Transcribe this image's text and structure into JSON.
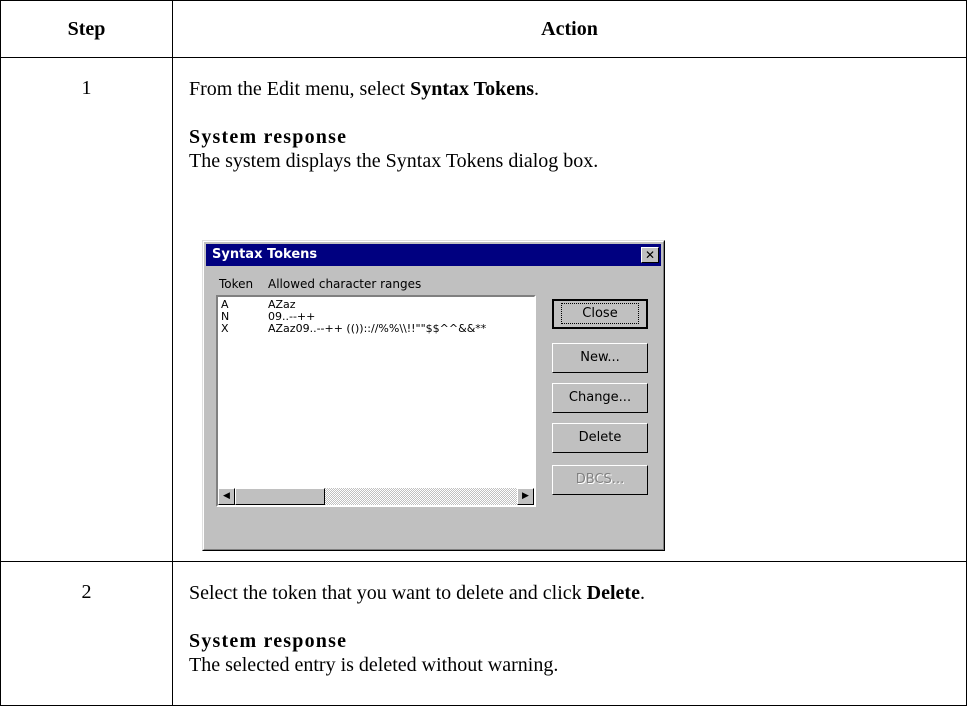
{
  "table": {
    "headers": {
      "step": "Step",
      "action": "Action"
    },
    "rows": [
      {
        "step": "1",
        "instruction_pre": "From the Edit menu, select ",
        "instruction_bold": "Syntax Tokens",
        "instruction_post": ".",
        "response_heading": "System response",
        "response_text": "The system displays the Syntax Tokens dialog box."
      },
      {
        "step": "2",
        "instruction_pre": "Select the token that you want to delete and click ",
        "instruction_bold": "Delete",
        "instruction_post": ".",
        "response_heading": "System response",
        "response_text": "The selected entry is deleted without warning."
      }
    ]
  },
  "dialog": {
    "title": "Syntax Tokens",
    "close_glyph": "✕",
    "columns": {
      "token": "Token",
      "ranges": "Allowed character ranges"
    },
    "list_items": [
      {
        "token": "A",
        "ranges": "AZaz"
      },
      {
        "token": "N",
        "ranges": "09..--++"
      },
      {
        "token": "X",
        "ranges": "AZaz09..--++ (()):://%%\\\\!!\"\"$$^^&&**"
      }
    ],
    "buttons": {
      "close": "Close",
      "new": "New...",
      "change": "Change...",
      "delete": "Delete",
      "dbcs": "DBCS..."
    },
    "scroll_left": "◀",
    "scroll_right": "▶"
  }
}
